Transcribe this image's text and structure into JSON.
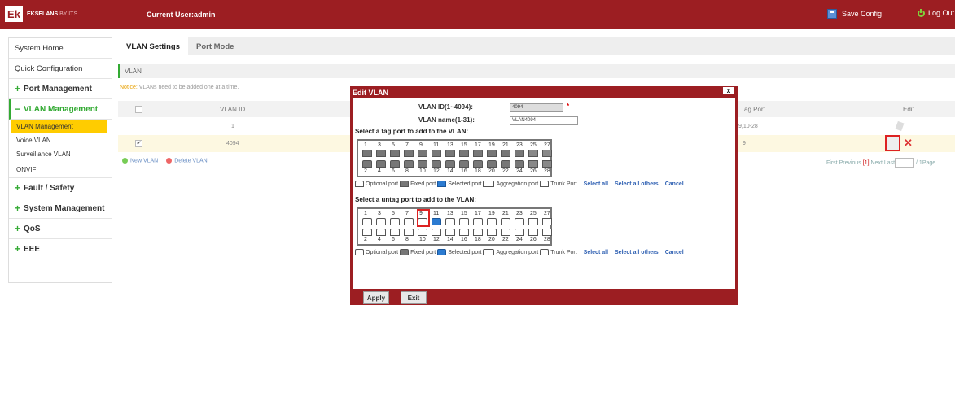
{
  "header": {
    "logo_mark": "Ek",
    "brand": "EKSELANS",
    "brand_suffix": "BY ITS",
    "current_user": "Current User:admin",
    "save_config": "Save Config",
    "logout": "Log Out",
    "colors": {
      "bar": "#9c1e22",
      "accent": "#33aa33"
    }
  },
  "sidebar": {
    "system_home": "System Home",
    "quick_config": "Quick Configuration",
    "port_mgmt": "Port Management",
    "vlan_mgmt": "VLAN Management",
    "vlan_sub": [
      "VLAN Management",
      "Voice VLAN",
      "Surveillance VLAN",
      "ONVIF"
    ],
    "fault_safety": "Fault / Safety",
    "system_mgmt": "System Management",
    "qos": "QoS",
    "eee": "EEE",
    "plus": "+",
    "minus": "−"
  },
  "tabs": [
    "VLAN Settings",
    "Port Mode"
  ],
  "section_label": "VLAN",
  "notice": {
    "prefix": "Notice:",
    "text": "VLANs need to be added one at a time."
  },
  "table": {
    "col_vlan_id": "VLAN ID",
    "col_tag_port": "Tag Port",
    "col_edit": "Edit",
    "rows": [
      {
        "vlan_id": "1",
        "tag_port": "9,10-28",
        "checked": false
      },
      {
        "vlan_id": "4094",
        "tag_port": "9",
        "checked": true
      }
    ],
    "check_mark": "✔"
  },
  "actions": {
    "new_vlan": "New VLAN",
    "delete_vlan": "Delete VLAN"
  },
  "pager": {
    "first": "First",
    "previous": "Previous",
    "current": "[1]",
    "next": "Next",
    "last": "Last",
    "suffix": "/ 1Page"
  },
  "dialog": {
    "title": "Edit VLAN",
    "close": "x",
    "vlan_id_label": "VLAN ID(1~4094):",
    "vlan_id_value": "4094",
    "required_mark": "*",
    "vlan_name_label": "VLAN name(1-31):",
    "vlan_name_value": "VLAN4094",
    "tag_title": "Select a tag port to add to the VLAN:",
    "untag_title": "Select a untag port to add to the VLAN:",
    "odd_ports": [
      "1",
      "3",
      "5",
      "7",
      "9",
      "11",
      "13",
      "15",
      "17",
      "19",
      "21",
      "23",
      "25",
      "27"
    ],
    "even_ports": [
      "2",
      "4",
      "6",
      "8",
      "10",
      "12",
      "14",
      "16",
      "18",
      "20",
      "22",
      "24",
      "26",
      "28"
    ],
    "legend": {
      "optional": "Optional port",
      "fixed": "Fixed port",
      "selected": "Selected port",
      "aggregation": "Aggregation port",
      "trunk": "Trunk Port",
      "select_all": "Select all",
      "select_others": "Select all others",
      "cancel": "Cancel"
    },
    "apply": "Apply",
    "exit": "Exit"
  }
}
